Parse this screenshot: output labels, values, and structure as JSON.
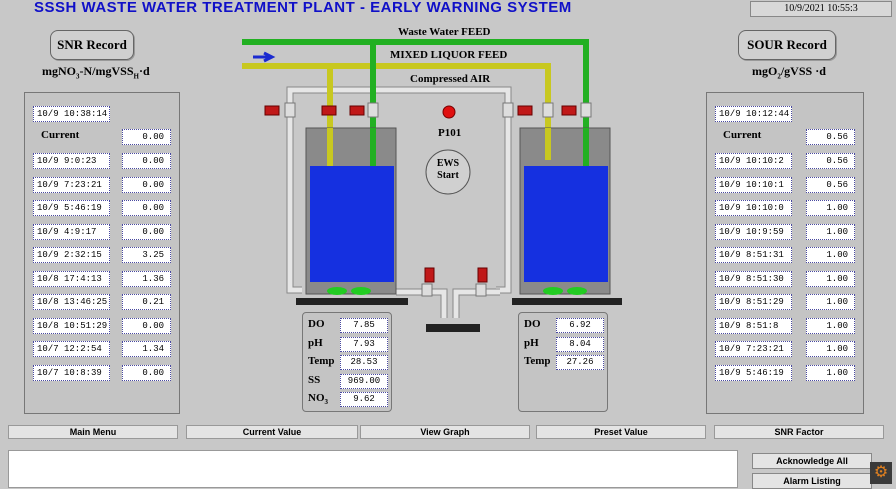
{
  "title": "SSSH WASTE WATER TREATMENT PLANT - EARLY WARNING SYSTEM",
  "datetime": "10/9/2021    10:55:3",
  "snr": {
    "button": "SNR Record",
    "unit_main": "mgNO",
    "unit_sub": "3",
    "unit_main2": "-N/mgVSS",
    "unit_sub2": "H",
    "unit_end": "·d",
    "header_time": "10/9 10:38:14",
    "current_label": "Current",
    "current_value": "0.00",
    "rows": [
      {
        "time": "10/9   9:0:23",
        "value": "0.00"
      },
      {
        "time": "10/9   7:23:21",
        "value": "0.00"
      },
      {
        "time": "10/9   5:46:19",
        "value": "0.00"
      },
      {
        "time": "10/9   4:9:17",
        "value": "0.00"
      },
      {
        "time": "10/9   2:32:15",
        "value": "3.25"
      },
      {
        "time": "10/8  17:4:13",
        "value": "1.36"
      },
      {
        "time": "10/8  13:46:25",
        "value": "0.21"
      },
      {
        "time": "10/8  10:51:29",
        "value": "0.00"
      },
      {
        "time": "10/7  12:2:54",
        "value": "1.34"
      },
      {
        "time": "10/7  10:8:39",
        "value": "0.00"
      }
    ]
  },
  "sour": {
    "button": "SOUR Record",
    "unit_main": "mgO",
    "unit_sub": "2",
    "unit_end": "/gVSS ·d",
    "header_time": "10/9  10:12:44",
    "current_label": "Current",
    "current_value": "0.56",
    "rows": [
      {
        "time": "10/9  10:10:2",
        "value": "0.56"
      },
      {
        "time": "10/9  10:10:1",
        "value": "0.56"
      },
      {
        "time": "10/9  10:10:0",
        "value": "1.00"
      },
      {
        "time": "10/9  10:9:59",
        "value": "1.00"
      },
      {
        "time": "10/9  8:51:31",
        "value": "1.00"
      },
      {
        "time": "10/9  8:51:30",
        "value": "1.00"
      },
      {
        "time": "10/9  8:51:29",
        "value": "1.00"
      },
      {
        "time": "10/9  8:51:8",
        "value": "1.00"
      },
      {
        "time": "10/9  7:23:21",
        "value": "1.00"
      },
      {
        "time": "10/9  5:46:19",
        "value": "1.00"
      }
    ]
  },
  "process": {
    "waste_feed": "Waste Water FEED",
    "mixed_feed": "MIXED LIQUOR FEED",
    "air": "Compressed AIR",
    "pump": "P101",
    "ews_start": "EWS Start",
    "left": [
      {
        "label": "DO",
        "value": "7.85"
      },
      {
        "label": "pH",
        "value": "7.93"
      },
      {
        "label": "Temp",
        "value": "28.53"
      },
      {
        "label": "SS",
        "value": "969.00"
      },
      {
        "label": "NO",
        "sub": "3",
        "value": "9.62"
      }
    ],
    "right": [
      {
        "label": "DO",
        "value": "6.92"
      },
      {
        "label": "pH",
        "value": "8.04"
      },
      {
        "label": "Temp",
        "value": "27.26"
      }
    ]
  },
  "nav": [
    "Main Menu",
    "Current Value",
    "View Graph",
    "Preset Value",
    "SNR Factor"
  ],
  "alarm": {
    "ack": "Acknowledge All",
    "listing": "Alarm Listing"
  },
  "colors": {
    "green": "#22b022",
    "yellow": "#c8c820",
    "pipe": "#e4e4e4",
    "water": "#1530e0",
    "title": "#1010c8",
    "valve": "#c01818"
  }
}
